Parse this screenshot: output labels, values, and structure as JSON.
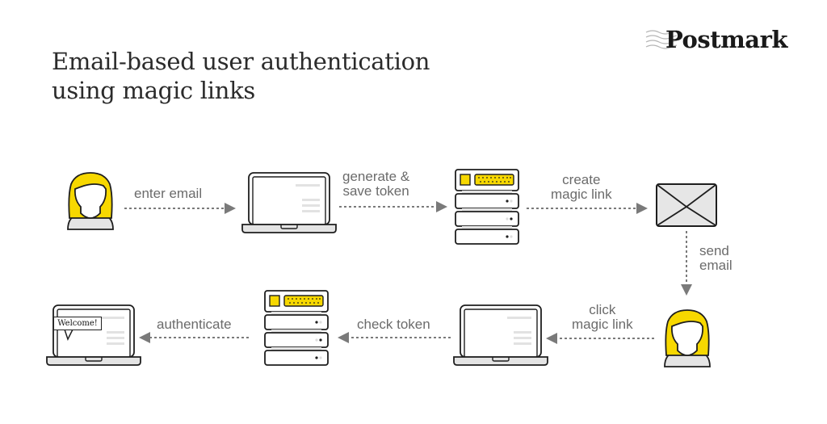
{
  "title": {
    "line1": "Email-based user authentication",
    "line2": "using magic links"
  },
  "brand": {
    "name": "Postmark",
    "accent_color": "#F7D800",
    "outline_color": "#1E1E1E",
    "arrow_color": "#7A7A7A",
    "text_color": "#6B6B6B"
  },
  "nodes": [
    {
      "id": "user-start",
      "type": "user",
      "icon": "user-icon"
    },
    {
      "id": "laptop-1",
      "type": "laptop",
      "icon": "laptop-icon"
    },
    {
      "id": "server-1",
      "type": "server",
      "icon": "server-icon"
    },
    {
      "id": "email",
      "type": "envelope",
      "icon": "envelope-icon"
    },
    {
      "id": "user-end",
      "type": "user",
      "icon": "user-icon"
    },
    {
      "id": "laptop-2",
      "type": "laptop",
      "icon": "laptop-icon"
    },
    {
      "id": "server-2",
      "type": "server",
      "icon": "server-icon"
    },
    {
      "id": "laptop-welcome",
      "type": "laptop",
      "icon": "laptop-icon",
      "badge": "Welcome!"
    }
  ],
  "steps": [
    {
      "from": "user-start",
      "to": "laptop-1",
      "label": "enter email"
    },
    {
      "from": "laptop-1",
      "to": "server-1",
      "label_line1": "generate &",
      "label_line2": "save token"
    },
    {
      "from": "server-1",
      "to": "email",
      "label_line1": "create",
      "label_line2": "magic link"
    },
    {
      "from": "email",
      "to": "user-end",
      "label_line1": "send",
      "label_line2": "email"
    },
    {
      "from": "user-end",
      "to": "laptop-2",
      "label_line1": "click",
      "label_line2": "magic link"
    },
    {
      "from": "laptop-2",
      "to": "server-2",
      "label": "check token"
    },
    {
      "from": "server-2",
      "to": "laptop-welcome",
      "label": "authenticate"
    }
  ]
}
